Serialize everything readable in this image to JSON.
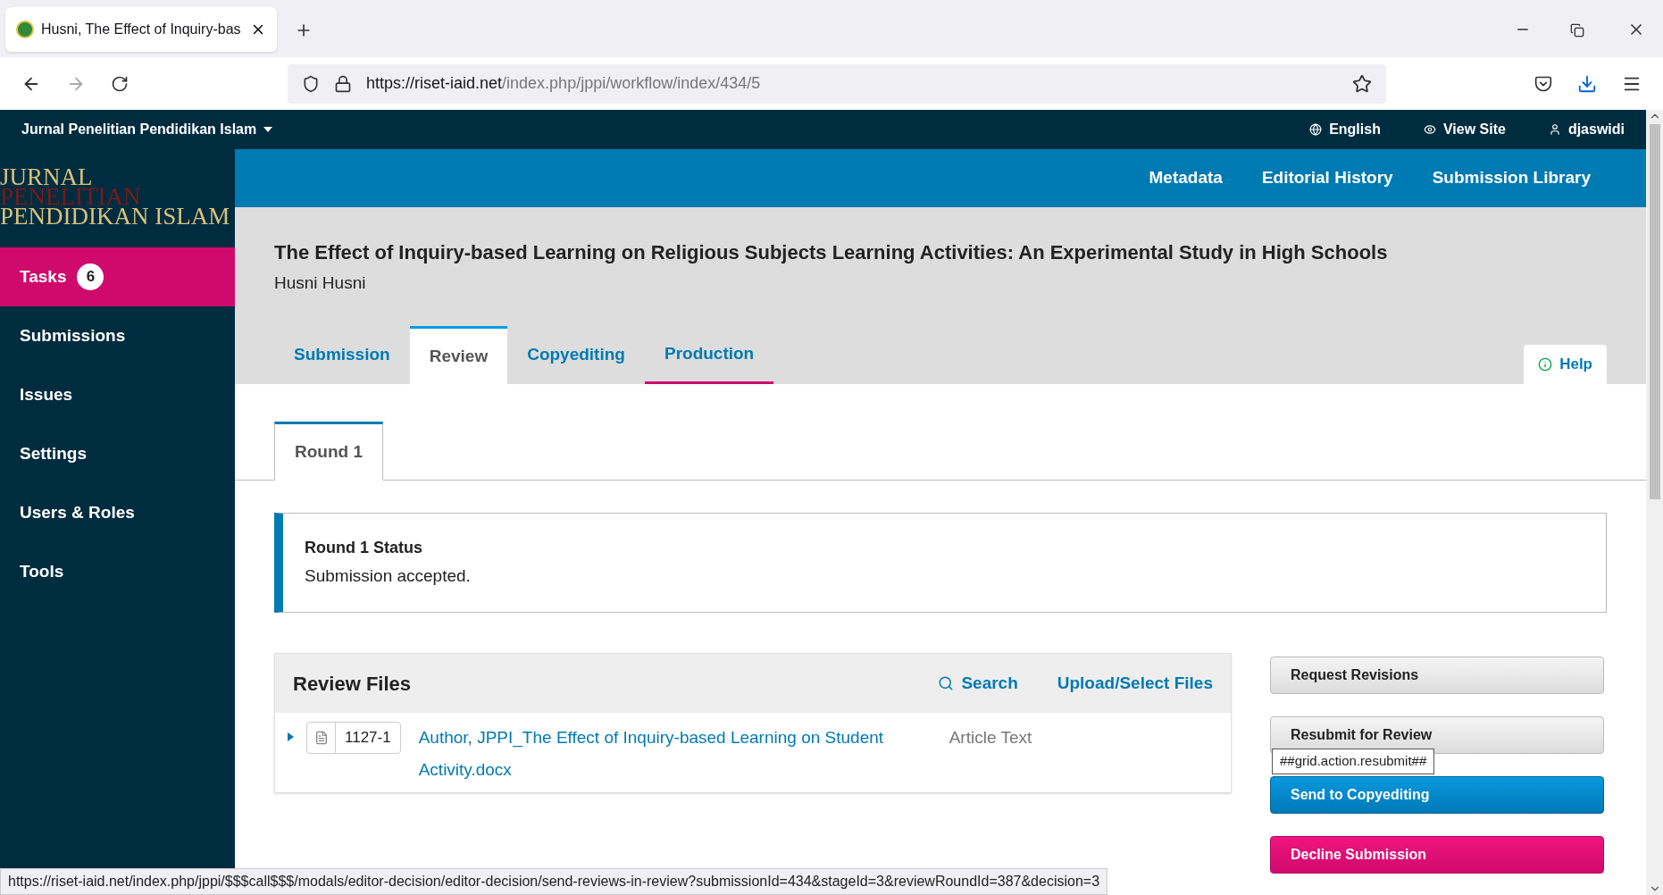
{
  "browser": {
    "tab_title": "Husni, The Effect of Inquiry-bas",
    "url_host": "https://riset-iaid.net",
    "url_path": "/index.php/jppi/workflow/index/434/5",
    "status_url": "https://riset-iaid.net/index.php/jppi/$$$call$$$/modals/editor-decision/editor-decision/send-reviews-in-review?submissionId=434&stageId=3&reviewRoundId=387&decision=3"
  },
  "topbar": {
    "journal": "Jurnal Penelitian Pendidikan Islam",
    "links": [
      {
        "kind": "globe",
        "label": "English"
      },
      {
        "kind": "eye",
        "label": "View Site"
      },
      {
        "kind": "user",
        "label": "djaswidi"
      }
    ]
  },
  "logo": {
    "lines": [
      "JURNAL",
      "PENELITIAN",
      "PENDIDIKAN ISLAM"
    ]
  },
  "header_nav": [
    "Metadata",
    "Editorial History",
    "Submission Library"
  ],
  "sidebar": {
    "items": [
      {
        "label": "Tasks",
        "badge": "6",
        "selected": true
      },
      {
        "label": "Submissions",
        "selected": false
      },
      {
        "label": "Issues",
        "selected": false
      },
      {
        "label": "Settings",
        "selected": false
      },
      {
        "label": "Users & Roles",
        "selected": false
      },
      {
        "label": "Tools",
        "selected": false
      }
    ]
  },
  "submission": {
    "title": "The Effect of Inquiry-based Learning on Religious Subjects Learning Activities: An Experimental Study in High Schools",
    "author": "Husni Husni"
  },
  "stage_tabs": [
    {
      "label": "Submission",
      "selected": false,
      "current": false
    },
    {
      "label": "Review",
      "selected": true,
      "current": false
    },
    {
      "label": "Copyediting",
      "selected": false,
      "current": false
    },
    {
      "label": "Production",
      "selected": false,
      "current": true
    }
  ],
  "help": "Help",
  "round_tabs": [
    {
      "label": "Round 1",
      "selected": true
    }
  ],
  "round_status": {
    "heading": "Round 1 Status",
    "text": "Submission accepted."
  },
  "review_files": {
    "title": "Review Files",
    "actions": [
      {
        "kind": "search",
        "label": "Search"
      },
      {
        "kind": "plain",
        "label": "Upload/Select Files"
      }
    ],
    "files": [
      {
        "expanded": false,
        "id": "1127-1",
        "name": "Author, JPPI_The Effect of Inquiry-based Learning on Student Activity.docx",
        "type": "Article Text"
      }
    ]
  },
  "decisions": [
    {
      "kind": "secondary",
      "label": "Request Revisions"
    },
    {
      "kind": "secondary",
      "label": "Resubmit for Review",
      "tooltip": "##grid.action.resubmit##"
    },
    {
      "kind": "primary",
      "label": "Send to Copyediting"
    },
    {
      "kind": "danger",
      "label": "Decline Submission"
    }
  ]
}
